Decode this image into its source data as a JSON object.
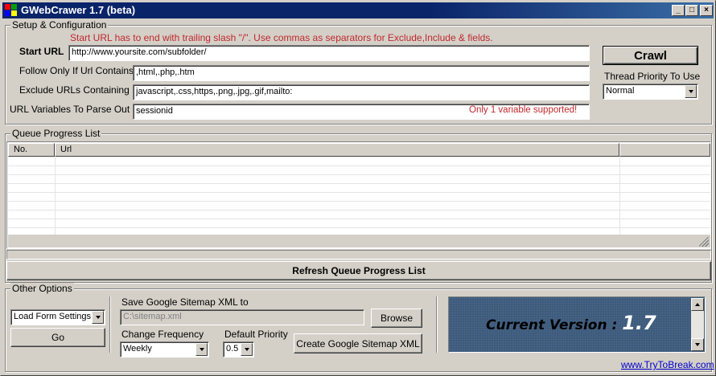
{
  "window": {
    "title": "GWebCrawer 1.7 (beta)",
    "controls": {
      "minimize": "_",
      "maximize": "□",
      "close": "×"
    }
  },
  "setup": {
    "legend": "Setup & Configuration",
    "notice": "Start URL has to end with trailing slash \"/\".  Use commas as separators for Exclude,Include & fields.",
    "start_url": {
      "label": "Start URL",
      "value": "http://www.yoursite.com/subfolder/"
    },
    "follow_only": {
      "label": "Follow Only If Url Contains",
      "value": ",html,.php,.htm"
    },
    "exclude": {
      "label": "Exclude URLs Containing",
      "value": "javascript,.css,https,.png,.jpg,.gif,mailto:"
    },
    "url_vars": {
      "label": "URL Variables To Parse Out",
      "value": "sessionid",
      "hint": "Only 1 variable supported!"
    },
    "crawl_button": "Crawl",
    "thread_priority": {
      "label": "Thread Priority To Use",
      "selected": "Normal"
    }
  },
  "queue": {
    "legend": "Queue Progress List",
    "columns": [
      "No.",
      "Url",
      ""
    ],
    "refresh_button": "Refresh Queue Progress List"
  },
  "options": {
    "legend": "Other Options",
    "form_settings": {
      "selected": "Load Form Settings"
    },
    "go_button": "Go",
    "sitemap": {
      "label": "Save Google Sitemap XML to",
      "path": "C:\\sitemap.xml",
      "browse_button": "Browse",
      "change_freq": {
        "label": "Change Frequency",
        "selected": "Weekly"
      },
      "priority": {
        "label": "Default Priority",
        "selected": "0.5"
      },
      "create_button": "Create Google Sitemap XML"
    },
    "version": {
      "prefix": "Current Version :",
      "number": "1.7"
    },
    "link": "www.TryToBreak.com"
  }
}
